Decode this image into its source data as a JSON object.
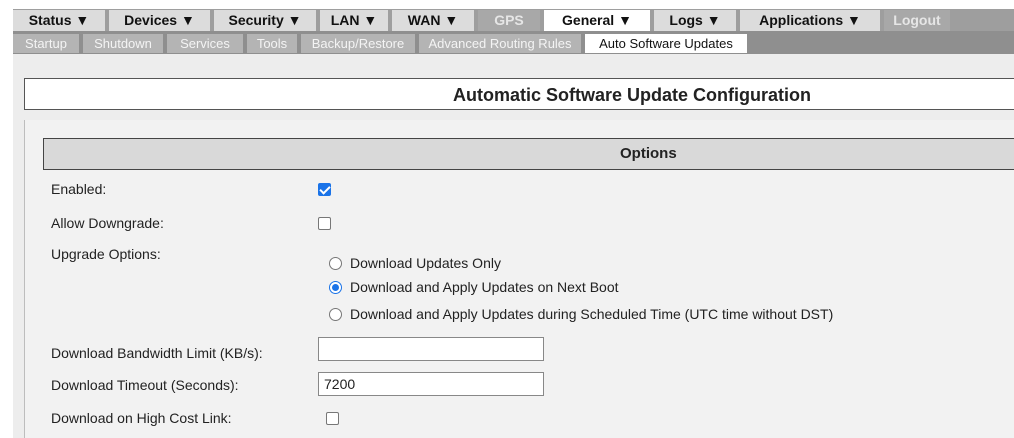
{
  "menu": [
    {
      "label": "Status ▼",
      "state": "normal"
    },
    {
      "label": "Devices ▼",
      "state": "normal"
    },
    {
      "label": "Security ▼",
      "state": "normal"
    },
    {
      "label": "LAN ▼",
      "state": "normal"
    },
    {
      "label": "WAN ▼",
      "state": "normal"
    },
    {
      "label": "GPS",
      "state": "gray"
    },
    {
      "label": "General ▼",
      "state": "active"
    },
    {
      "label": "Logs ▼",
      "state": "normal"
    },
    {
      "label": "Applications ▼",
      "state": "normal"
    },
    {
      "label": "Logout",
      "state": "gray"
    }
  ],
  "tabs": [
    {
      "label": "Startup",
      "active": false
    },
    {
      "label": "Shutdown",
      "active": false
    },
    {
      "label": "Services",
      "active": false
    },
    {
      "label": "Tools",
      "active": false
    },
    {
      "label": "Backup/Restore",
      "active": false
    },
    {
      "label": "Advanced Routing Rules",
      "active": false
    },
    {
      "label": "Auto Software Updates",
      "active": true
    }
  ],
  "page": {
    "title": "Automatic Software Update Configuration",
    "options_title": "Options"
  },
  "form": {
    "enabled": {
      "label": "Enabled:",
      "checked": true
    },
    "allow_downgrade": {
      "label": "Allow Downgrade:",
      "checked": false
    },
    "upgrade_options": {
      "label": "Upgrade Options:",
      "choices": [
        {
          "label": "Download Updates Only",
          "selected": false
        },
        {
          "label": "Download and Apply Updates on Next Boot",
          "selected": true
        },
        {
          "label": "Download and Apply Updates during Scheduled Time (UTC time without DST)",
          "selected": false
        }
      ]
    },
    "bandwidth_limit": {
      "label": "Download Bandwidth Limit (KB/s):",
      "value": ""
    },
    "timeout": {
      "label": "Download Timeout (Seconds):",
      "value": "7200"
    },
    "high_cost_link": {
      "label": "Download on High Cost Link:",
      "checked": false
    }
  },
  "colors": {
    "accent": "#1a73e8",
    "menu_bg": "#dcdcdc",
    "menu_disabled": "#a8a8a8",
    "tab_bg": "#b4b4b4",
    "panel_bg": "#f2f2f2"
  }
}
